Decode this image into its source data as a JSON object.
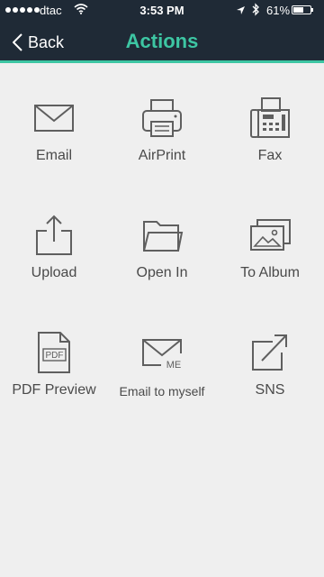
{
  "status_bar": {
    "carrier": "dtac",
    "time": "3:53 PM",
    "battery": "61%",
    "battery_level": 0.61
  },
  "nav": {
    "back_label": "Back",
    "title": "Actions"
  },
  "actions": [
    {
      "label": "Email",
      "icon": "envelope-icon"
    },
    {
      "label": "AirPrint",
      "icon": "printer-icon"
    },
    {
      "label": "Fax",
      "icon": "fax-icon"
    },
    {
      "label": "Upload",
      "icon": "upload-icon"
    },
    {
      "label": "Open In",
      "icon": "folder-icon"
    },
    {
      "label": "To Album",
      "icon": "photo-album-icon"
    },
    {
      "label": "PDF Preview",
      "icon": "pdf-file-icon"
    },
    {
      "label": "Email to myself",
      "icon": "envelope-me-icon"
    },
    {
      "label": "SNS",
      "icon": "share-arrow-icon"
    }
  ],
  "colors": {
    "accent": "#3dc6a3",
    "header_bg": "#1f2a36",
    "background": "#efefef",
    "icon": "#5f5f5f"
  }
}
